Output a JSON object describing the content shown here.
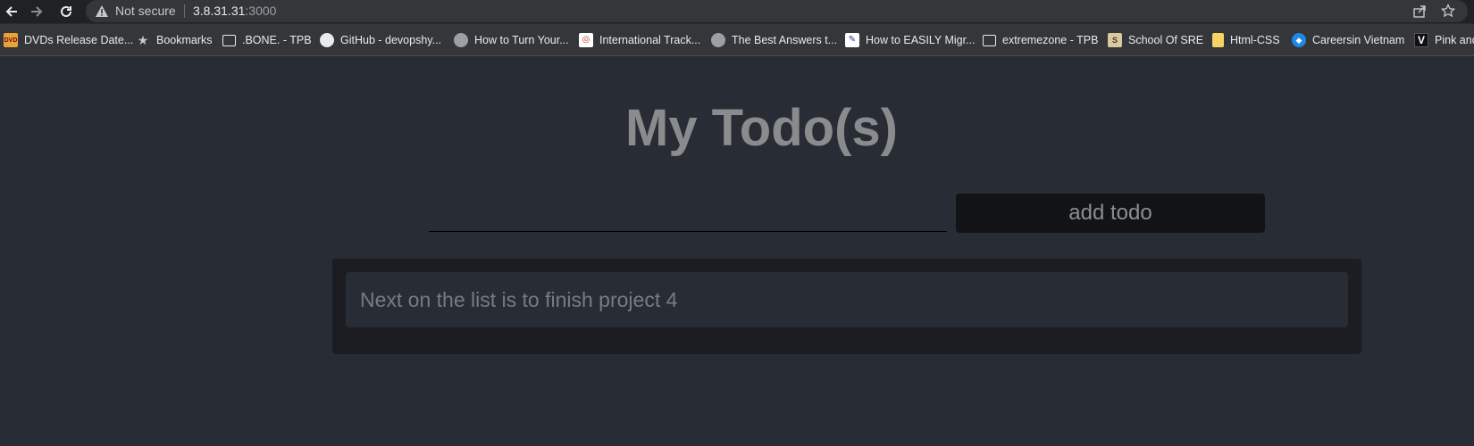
{
  "browser": {
    "security_label": "Not secure",
    "url_host": "3.8.31.31",
    "url_port": ":3000",
    "icons": [
      "back-icon",
      "forward-icon",
      "reload-icon",
      "warning-icon",
      "share-icon",
      "star-icon"
    ]
  },
  "bookmarks": [
    {
      "label": "DVDs Release Date...",
      "icon": "dvd-favicon"
    },
    {
      "label": "Bookmarks",
      "icon": "star-icon"
    },
    {
      "label": ".BONE. - TPB",
      "icon": "tpb-favicon"
    },
    {
      "label": "GitHub - devopshy...",
      "icon": "github-icon"
    },
    {
      "label": "How to Turn Your...",
      "icon": "globe-icon"
    },
    {
      "label": "International Track...",
      "icon": "search-favicon"
    },
    {
      "label": "The Best Answers t...",
      "icon": "globe-icon"
    },
    {
      "label": "How to EASILY Migr...",
      "icon": "doc-favicon"
    },
    {
      "label": "extremezone - TPB",
      "icon": "tpb-favicon"
    },
    {
      "label": "School Of SRE",
      "icon": "school-favicon"
    },
    {
      "label": "Html-CSS",
      "icon": "folder-icon"
    },
    {
      "label": "Careersin Vietnam",
      "icon": "careers-favicon"
    },
    {
      "label": "Pink and",
      "icon": "v-favicon"
    }
  ],
  "app": {
    "title": "My Todo(s)",
    "input_value": "",
    "add_button_label": "add todo",
    "todos": [
      {
        "text": "Next on the list is to finish project 4"
      }
    ]
  }
}
